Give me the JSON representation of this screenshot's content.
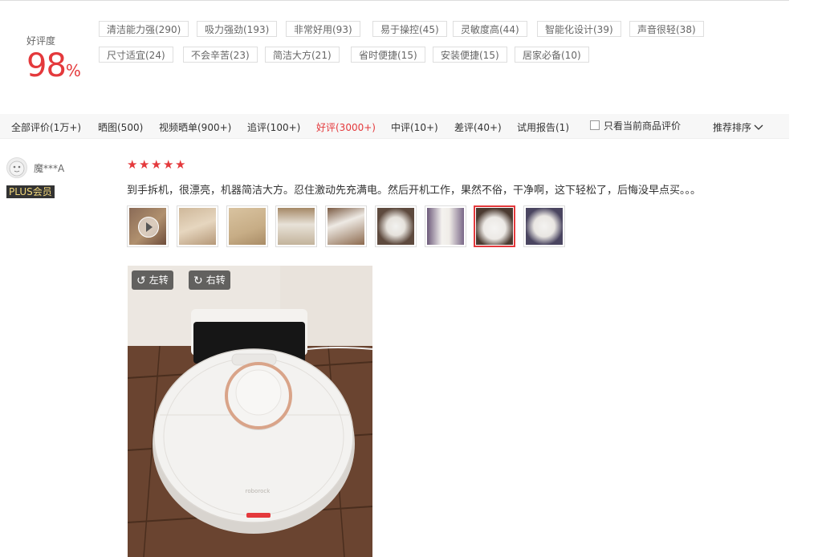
{
  "rating": {
    "label": "好评度",
    "value": "98",
    "unit": "%"
  },
  "tags": [
    "清洁能力强(290)",
    "吸力强劲(193)",
    "非常好用(93)",
    "易于操控(45)",
    "灵敏度高(44)",
    "智能化设计(39)",
    "声音很轻(38)",
    "尺寸适宜(24)",
    "不会辛苦(23)",
    "简洁大方(21)",
    "省时便捷(15)",
    "安装便捷(15)",
    "居家必备(10)"
  ],
  "filters": [
    "全部评价(1万+)",
    "晒图(500)",
    "视频晒单(900+)",
    "追评(100+)",
    "好评(3000+)",
    "中评(10+)",
    "差评(40+)",
    "试用报告(1)"
  ],
  "active_filter": "好评(3000+)",
  "only_current": "只看当前商品评价",
  "sort": {
    "label": "推荐排序",
    "icon": "chevron-down-icon"
  },
  "review": {
    "user": "魔***A",
    "badge": "PLUS会员",
    "stars": 5,
    "text": "到手拆机，很漂亮，机器简洁大方。忍住激动先充满电。然后开机工作，果然不俗，干净啊，这下轻松了，后悔没早点买。。。"
  },
  "viewer": {
    "rotate_left": "左转",
    "rotate_right": "右转",
    "brand": "roborock"
  },
  "colors": {
    "accent": "#e4393c",
    "badge_bg": "#333333",
    "badge_text": "#f0d67a"
  }
}
